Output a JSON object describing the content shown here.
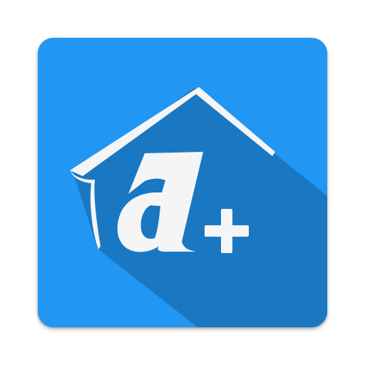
{
  "app_icon": {
    "logo_text": "a+",
    "colors": {
      "background": "#2196f3",
      "long_shadow": "#1a78c2",
      "glyph": "#f5f5f5"
    },
    "icons": [
      "house-roof-icon",
      "letter-a-glyph",
      "plus-icon"
    ]
  }
}
